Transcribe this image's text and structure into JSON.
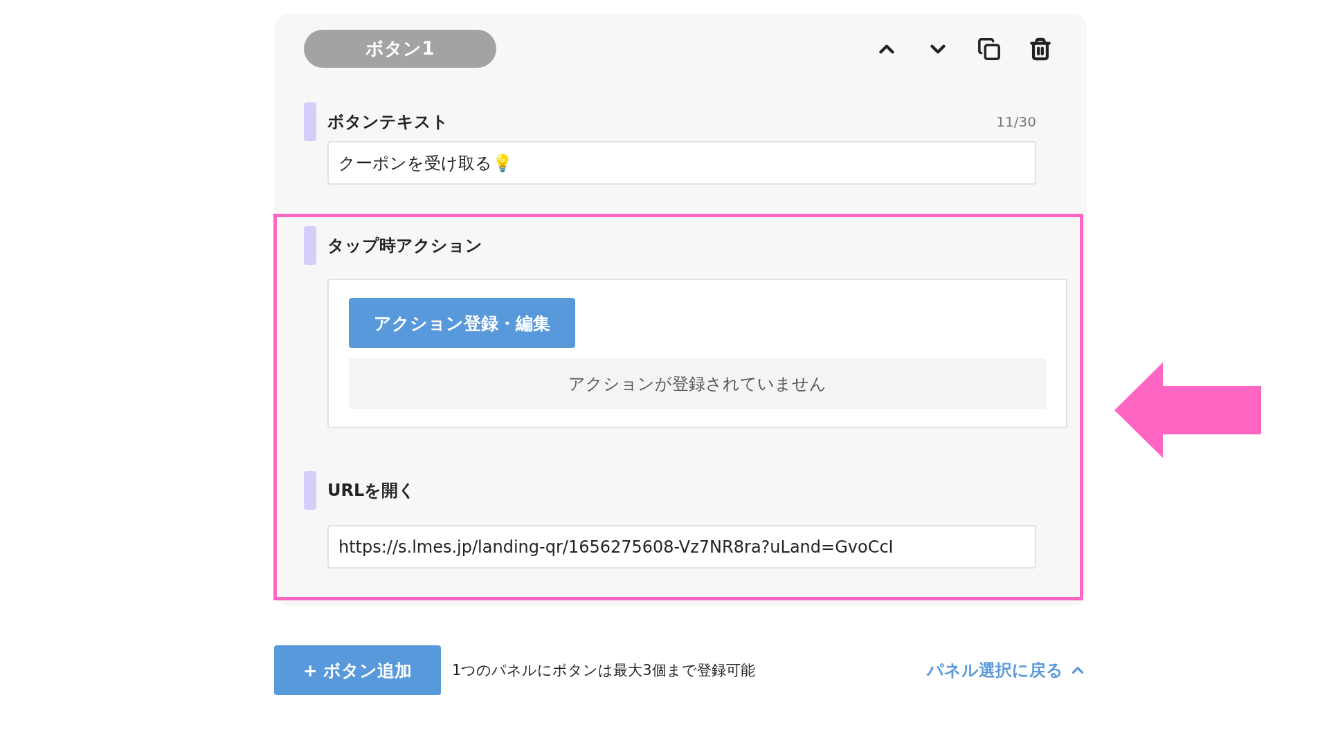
{
  "button_panel": {
    "badge": "ボタン1",
    "counter": "11/30",
    "fields": [
      {
        "label": "ボタンテキスト",
        "value": "クーポンを受け取る💡"
      }
    ],
    "tap_action": {
      "label": "タップ時アクション",
      "register_button": "アクション登録・編集",
      "empty_message": "アクションが登録されていません"
    },
    "url": {
      "label": "URLを開く",
      "value": "https://s.lmes.jp/landing-qr/1656275608-Vz7NR8ra?uLand=GvoCcI"
    }
  },
  "footer": {
    "add_button": "+ ボタン追加",
    "note": "1つのパネルにボタンは最大3個まで登録可能",
    "back_link": "パネル選択に戻る"
  }
}
